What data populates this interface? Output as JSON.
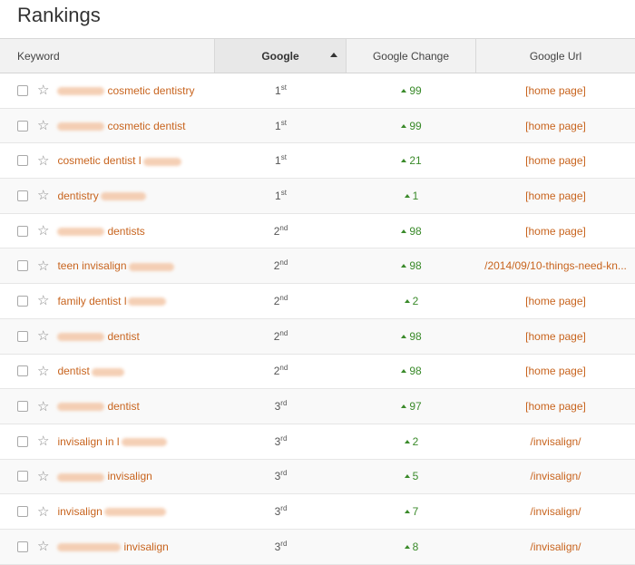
{
  "page": {
    "title": "Rankings"
  },
  "columns": {
    "keyword": "Keyword",
    "google": "Google",
    "google_change": "Google Change",
    "google_url": "Google Url"
  },
  "rows": [
    {
      "pre_blur": 52,
      "text": "cosmetic dentistry",
      "post_blur": 0,
      "rank": "1",
      "suffix": "st",
      "change": "99",
      "url": "[home page]"
    },
    {
      "pre_blur": 52,
      "text": "cosmetic dentist",
      "post_blur": 0,
      "rank": "1",
      "suffix": "st",
      "change": "99",
      "url": "[home page]"
    },
    {
      "pre_blur": 0,
      "text": "cosmetic dentist l",
      "post_blur": 42,
      "rank": "1",
      "suffix": "st",
      "change": "21",
      "url": "[home page]"
    },
    {
      "pre_blur": 0,
      "text": "dentistry",
      "post_blur": 50,
      "rank": "1",
      "suffix": "st",
      "change": "1",
      "url": "[home page]"
    },
    {
      "pre_blur": 52,
      "text": "dentists",
      "post_blur": 0,
      "rank": "2",
      "suffix": "nd",
      "change": "98",
      "url": "[home page]"
    },
    {
      "pre_blur": 0,
      "text": "teen invisalign",
      "post_blur": 50,
      "rank": "2",
      "suffix": "nd",
      "change": "98",
      "url": "/2014/09/10-things-need-kn..."
    },
    {
      "pre_blur": 0,
      "text": "family dentist l",
      "post_blur": 42,
      "rank": "2",
      "suffix": "nd",
      "change": "2",
      "url": "[home page]"
    },
    {
      "pre_blur": 52,
      "text": "dentist",
      "post_blur": 0,
      "rank": "2",
      "suffix": "nd",
      "change": "98",
      "url": "[home page]"
    },
    {
      "pre_blur": 0,
      "text": "dentist",
      "post_blur": 36,
      "rank": "2",
      "suffix": "nd",
      "change": "98",
      "url": "[home page]"
    },
    {
      "pre_blur": 52,
      "text": "dentist",
      "post_blur": 0,
      "rank": "3",
      "suffix": "rd",
      "change": "97",
      "url": "[home page]"
    },
    {
      "pre_blur": 0,
      "text": "invisalign in l",
      "post_blur": 50,
      "rank": "3",
      "suffix": "rd",
      "change": "2",
      "url": "/invisalign/"
    },
    {
      "pre_blur": 52,
      "text": "invisalign",
      "post_blur": 0,
      "rank": "3",
      "suffix": "rd",
      "change": "5",
      "url": "/invisalign/"
    },
    {
      "pre_blur": 0,
      "text": "invisalign",
      "post_blur": 68,
      "rank": "3",
      "suffix": "rd",
      "change": "7",
      "url": "/invisalign/"
    },
    {
      "pre_blur": 70,
      "text": "invisalign",
      "post_blur": 0,
      "rank": "3",
      "suffix": "rd",
      "change": "8",
      "url": "/invisalign/"
    }
  ]
}
